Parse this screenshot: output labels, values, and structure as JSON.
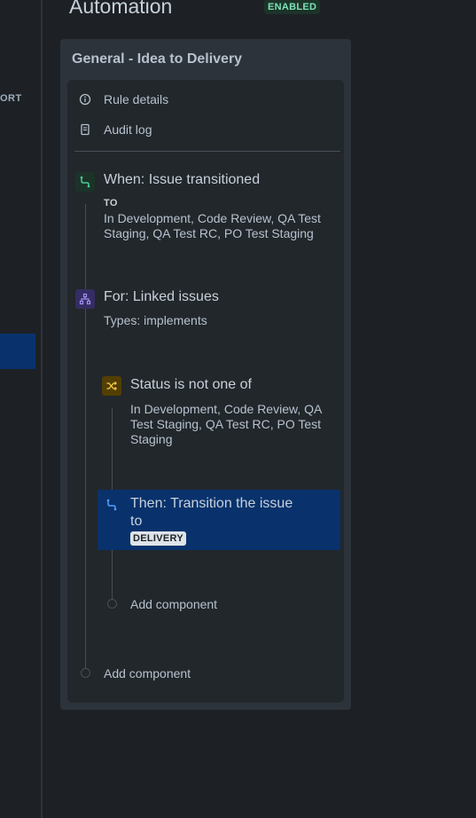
{
  "page": {
    "title": "Automation",
    "status_badge": "ENABLED"
  },
  "left_nav": {
    "fragment": "ORT"
  },
  "rule": {
    "name": "General - Idea to Delivery",
    "menu": [
      {
        "label": "Rule details",
        "icon": "info-icon"
      },
      {
        "label": "Audit log",
        "icon": "document-icon"
      }
    ],
    "trigger": {
      "title": "When: Issue transitioned",
      "to_label": "TO",
      "statuses": "In Development, Code Review, QA Test Staging, QA Test RC, PO Test Staging",
      "icon": "transition-icon",
      "color": "#1c3329"
    },
    "branch": {
      "title": "For: Linked issues",
      "types": "Types: implements",
      "icon": "branch-icon",
      "color": "#352c63"
    },
    "condition": {
      "title": "Status is not one of",
      "statuses": "In Development, Code Review, QA Test Staging, QA Test RC, PO Test Staging",
      "icon": "shuffle-icon",
      "color": "#533f04"
    },
    "action": {
      "title": "Then: Transition the issue",
      "to_text": "to",
      "target_status": "DELIVERY",
      "icon": "transition-icon"
    },
    "add_component_inner": "Add component",
    "add_component_outer": "Add component"
  },
  "colors": {
    "background": "#1d2125",
    "panel": "#2c333a",
    "inner_panel": "#22272b",
    "selected": "#09326c",
    "enabled_text": "#7ee2b8"
  }
}
